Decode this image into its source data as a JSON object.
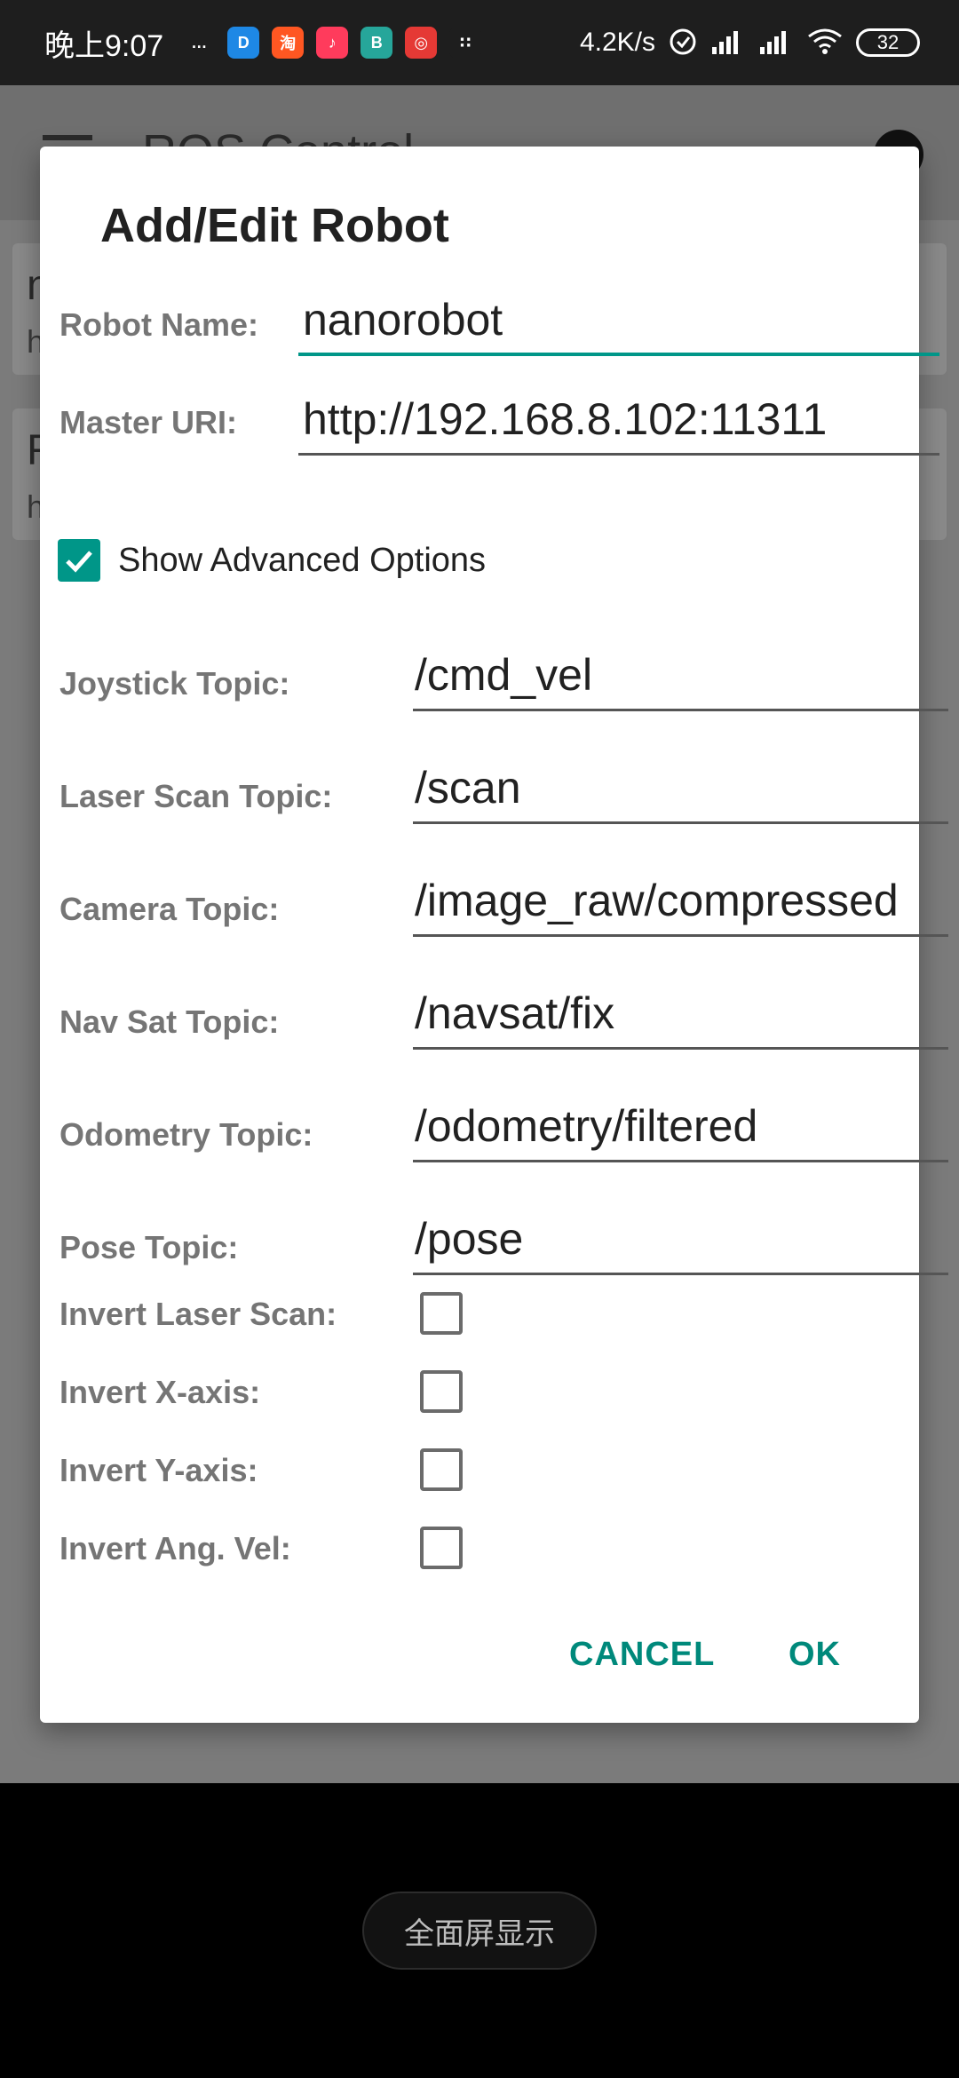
{
  "status_bar": {
    "time": "晚上9:07",
    "app_icons": [
      {
        "name": "chat-bubble-icon",
        "glyph": "…",
        "color": "#1e1e1e"
      },
      {
        "name": "app-d-icon",
        "glyph": "D",
        "color": "#1e88e5"
      },
      {
        "name": "taobao-icon",
        "glyph": "淘",
        "color": "#ff5722"
      },
      {
        "name": "tiktok-icon",
        "glyph": "♪",
        "color": "#ff3b5c"
      },
      {
        "name": "boss-icon",
        "glyph": "B",
        "color": "#26a69a"
      },
      {
        "name": "target-app-icon",
        "glyph": "◎",
        "color": "#e53935"
      },
      {
        "name": "more-apps-icon",
        "glyph": "∷",
        "color": "#1e1e1e"
      }
    ],
    "net_speed": "4.2K/s",
    "battery": "32"
  },
  "background_app": {
    "title": "ROS Control",
    "cards": [
      {
        "title": "n",
        "subtitle": "h"
      },
      {
        "title": "R",
        "subtitle": "h"
      }
    ]
  },
  "dialog": {
    "title": "Add/Edit Robot",
    "robot_name_label": "Robot Name:",
    "robot_name_value": "nanorobot",
    "master_uri_label": "Master URI:",
    "master_uri_value": "http://192.168.8.102:11311",
    "show_advanced_label": "Show Advanced Options",
    "show_advanced_checked": true,
    "advanced_fields": [
      {
        "label": "Joystick Topic:",
        "value": "/cmd_vel"
      },
      {
        "label": "Laser Scan Topic:",
        "value": "/scan"
      },
      {
        "label": "Camera Topic:",
        "value": "/image_raw/compressed"
      },
      {
        "label": "Nav Sat Topic:",
        "value": "/navsat/fix"
      },
      {
        "label": "Odometry Topic:",
        "value": "/odometry/filtered"
      },
      {
        "label": "Pose Topic:",
        "value": "/pose"
      }
    ],
    "invert_options": [
      {
        "label": "Invert Laser Scan:",
        "checked": false
      },
      {
        "label": "Invert X-axis:",
        "checked": false
      },
      {
        "label": "Invert Y-axis:",
        "checked": false
      },
      {
        "label": "Invert Ang. Vel:",
        "checked": false
      }
    ],
    "cancel_label": "CANCEL",
    "ok_label": "OK"
  },
  "fullscreen_button_label": "全面屏显示",
  "colors": {
    "accent": "#009688",
    "button_text": "#00897b"
  }
}
